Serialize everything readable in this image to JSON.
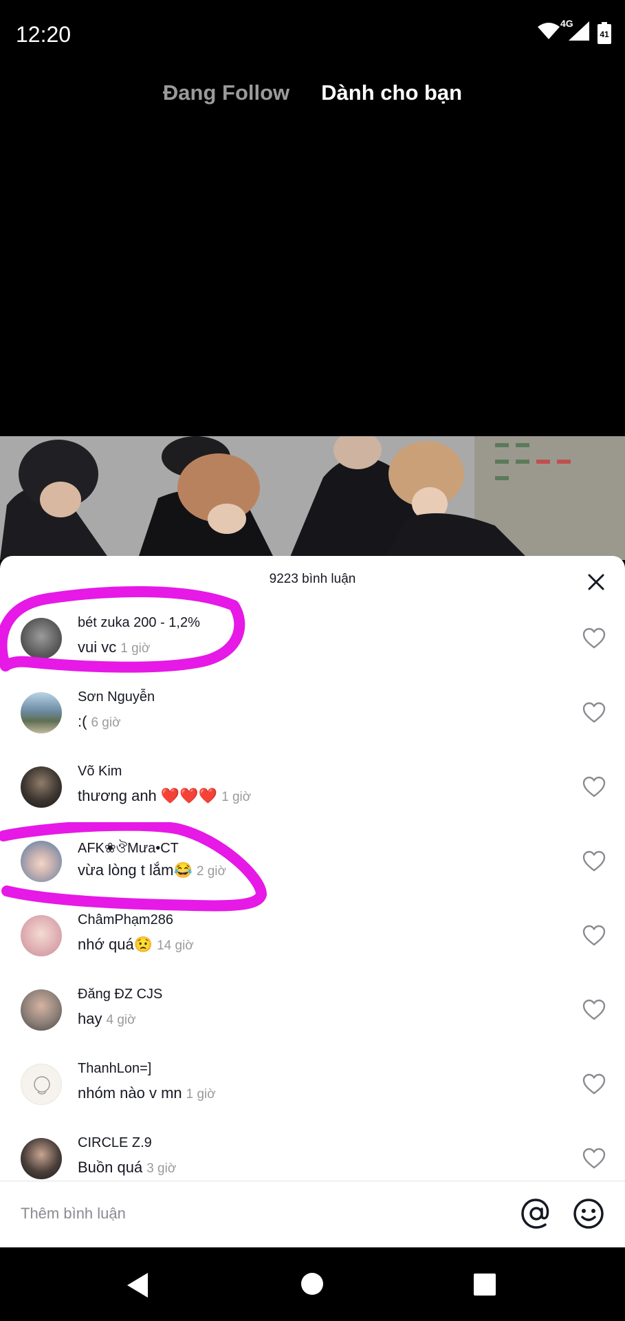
{
  "status_bar": {
    "time": "12:20",
    "network": "4G",
    "battery": "41"
  },
  "top_tabs": [
    {
      "label": "Đang Follow",
      "active": false
    },
    {
      "label": "Dành cho bạn",
      "active": true
    }
  ],
  "comments_sheet": {
    "count_label": "9223 bình luận",
    "comments": [
      {
        "username": "bét zuka 200 - 1,2%",
        "text": "vui vc",
        "time": "1 giờ",
        "avatar_color": "#6b6b6b"
      },
      {
        "username": "Sơn Nguyễn",
        "text": ":(",
        "time": "6 giờ",
        "avatar_color": "#4f7a9a"
      },
      {
        "username": "Võ Kim",
        "text": "thương anh ❤️❤️❤️",
        "time": "1 giờ",
        "avatar_color": "#3a3530"
      },
      {
        "username": "AFK❀ঔMưa•CT",
        "text": "vừa lòng t lắm😂",
        "time": "2 giờ",
        "avatar_color": "#7d8ea8"
      },
      {
        "username": "ChâmPhạm286",
        "text": "nhớ quá😟",
        "time": "14 giờ",
        "avatar_color": "#d9a6a8"
      },
      {
        "username": "Đăng ĐZ CJS",
        "text": "hay",
        "time": "4 giờ",
        "avatar_color": "#8c7f78"
      },
      {
        "username": "ThanhLon=]",
        "text": "nhóm nào v mn",
        "time": "1 giờ",
        "avatar_color": "#f3efe8"
      },
      {
        "username": "CIRCLE Z.9",
        "text": "Buồn quá",
        "time": "3 giờ",
        "avatar_color": "#2c2a29"
      }
    ]
  },
  "input_bar": {
    "placeholder": "Thêm bình luận"
  },
  "colors": {
    "highlight": "#e619e6",
    "heart_stroke": "#8a8b91"
  }
}
